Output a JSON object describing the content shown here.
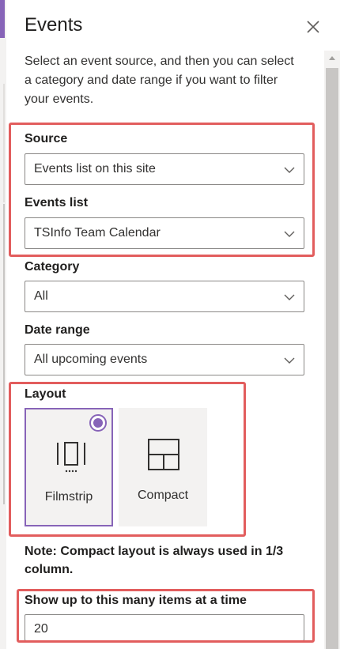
{
  "panel": {
    "title": "Events",
    "intro": "Select an event source, and then you can select a category and date range if you want to filter your events."
  },
  "fields": {
    "source": {
      "label": "Source",
      "value": "Events list on this site"
    },
    "events_list": {
      "label": "Events list",
      "value": "TSInfo Team Calendar"
    },
    "category": {
      "label": "Category",
      "value": "All"
    },
    "date_range": {
      "label": "Date range",
      "value": "All upcoming events"
    }
  },
  "layout": {
    "label": "Layout",
    "options": [
      {
        "label": "Filmstrip",
        "icon": "filmstrip-icon",
        "selected": true
      },
      {
        "label": "Compact",
        "icon": "compact-icon",
        "selected": false
      }
    ],
    "note": "Note: Compact layout is always used in 1/3 column."
  },
  "items": {
    "label": "Show up to this many items at a time",
    "value": "20"
  },
  "colors": {
    "accent": "#8764b8",
    "highlight": "#e25d5d",
    "card_bg": "#f3f2f1"
  }
}
